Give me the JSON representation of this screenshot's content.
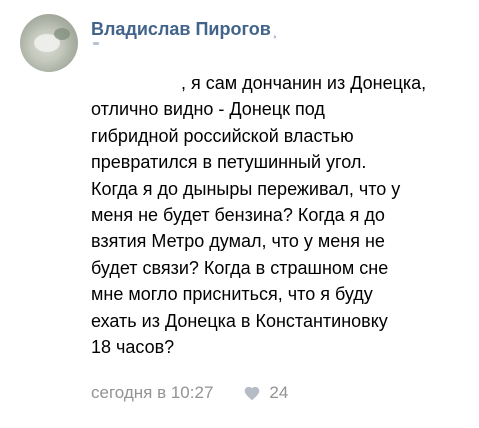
{
  "comment": {
    "author": "Владислав Пирогов",
    "author_suffix": "¸",
    "text_lines": [
      ", я сам дончанин из Донецка,",
      "отлично видно - Донецк под",
      "гибридной российской властью",
      "превратился в петушинный угол.",
      "Когда я до дыныры переживал, что у",
      "меня не будет бензина? Когда я до",
      "взятия Метро думал, что у меня не",
      "будет связи? Когда в страшном сне",
      "мне могло присниться, что я буду",
      "ехать из Донецка в Константиновку",
      "18 часов?"
    ],
    "timestamp": "сегодня в 10:27",
    "likes": "24"
  },
  "icons": {
    "like": "heart-icon",
    "avatar": "user-avatar-image"
  },
  "colors": {
    "author": "#42648b",
    "meta": "#939393",
    "text": "#000000",
    "background": "#ffffff"
  }
}
